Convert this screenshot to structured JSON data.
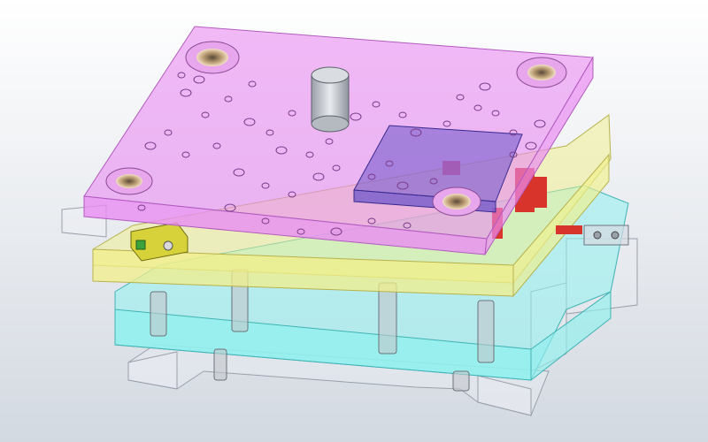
{
  "viewport": {
    "background_top": "#ffffff",
    "background_bottom": "#d3d9e1"
  },
  "palette": {
    "top_plate": "#e98cf2",
    "top_plate_edge": "#b25bbf",
    "stripper_plate": "#f1ef8a",
    "stripper_plate_edge": "#b8b24d",
    "die_plate": "#8ff0ee",
    "die_plate_edge": "#3fb3b4",
    "base_frame": "#eef0f5",
    "base_frame_edge": "#9aa0ab",
    "pocket": "#6d56c8",
    "sensor": "#d8d23a",
    "parts_red": "#d9342b",
    "guide_post": "#c3c6cc"
  },
  "assembly": {
    "layers": [
      "top-plate",
      "insert-pocket",
      "stripper-plate",
      "die-plate",
      "base-frame"
    ],
    "guide_bushings": 4,
    "shank": 1
  }
}
